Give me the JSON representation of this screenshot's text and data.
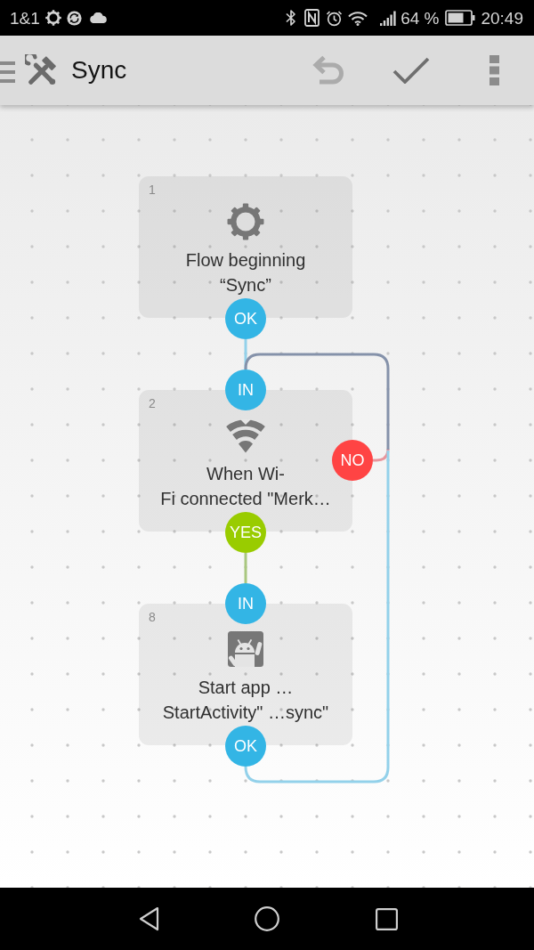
{
  "status_bar": {
    "carrier": "1&1",
    "battery": "64 %",
    "time": "20:49"
  },
  "app_bar": {
    "title": "Sync",
    "actions": [
      {
        "kind": "undo",
        "disabled": true
      },
      {
        "kind": "confirm",
        "disabled": false
      },
      {
        "kind": "more",
        "disabled": false
      }
    ]
  },
  "flow": {
    "nodes": [
      {
        "number": "1",
        "kind": "flow_beginning",
        "label": "Flow beginning\n“Sync”",
        "ports": [
          {
            "label": "OK",
            "color": "#33b5e5"
          }
        ]
      },
      {
        "number": "2",
        "kind": "wifi_connected",
        "label": "When Wi-\nFi connected \"Merk…",
        "ports": [
          {
            "label": "IN",
            "color": "#33b5e5"
          },
          {
            "label": "NO",
            "color": "#ff4444"
          },
          {
            "label": "YES",
            "color": "#99cc00"
          }
        ]
      },
      {
        "number": "8",
        "kind": "start_app",
        "label": "Start app …\nStartActivity\" …sync\"",
        "ports": [
          {
            "label": "IN",
            "color": "#33b5e5"
          },
          {
            "label": "OK",
            "color": "#33b5e5"
          }
        ]
      }
    ]
  }
}
